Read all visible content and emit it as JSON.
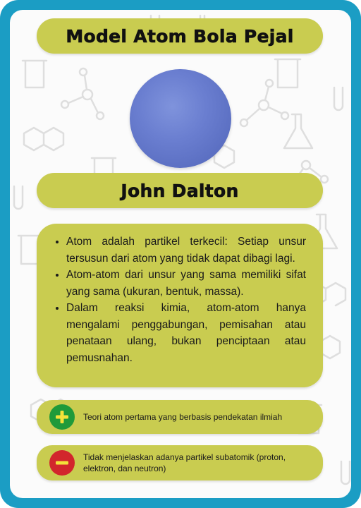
{
  "card": {
    "title": "Model Atom Bola Pejal",
    "scientist": "John Dalton",
    "points": [
      "Atom adalah partikel terkecil: Setiap unsur tersusun dari atom yang tidak dapat dibagi lagi.",
      "Atom-atom dari unsur yang sama memiliki sifat yang sama (ukuran, bentuk, massa).",
      "Dalam reaksi kimia, atom-atom hanya mengalami penggabungan, pemisahan atau penataan ulang, bukan penciptaan atau pemusnahan."
    ],
    "advantage": "Teori atom pertama yang berbasis pendekatan ilmiah",
    "disadvantage": "Tidak menjelaskan adanya partikel subatomik (proton, elektron, dan neutron)"
  },
  "icons": {
    "plus": "plus-icon",
    "minus": "minus-icon",
    "sphere": "solid-sphere-atom-illustration",
    "background": "chemistry-glassware-pattern"
  },
  "colors": {
    "frame": "#1b9dc4",
    "panel": "#c9cc50",
    "sphere": "#6a7ed0",
    "plus_badge": "#1f9a3a",
    "plus_sign": "#f3e23a",
    "minus_badge": "#d2262c",
    "minus_sign": "#f3e23a"
  }
}
